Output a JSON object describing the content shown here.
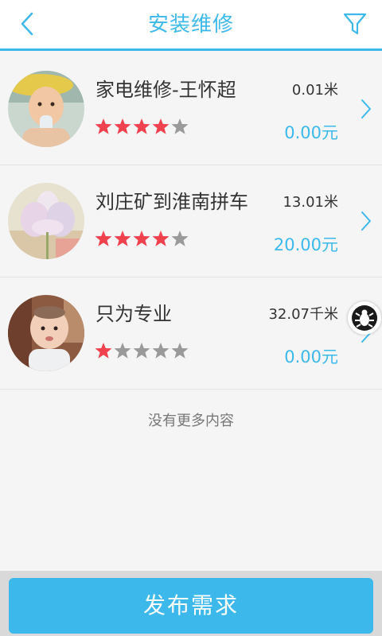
{
  "header": {
    "title": "安装维修",
    "back_icon": "chevron-left-icon",
    "filter_icon": "filter-funnel-icon"
  },
  "colors": {
    "accent": "#3cb9ea",
    "star_filled": "#f0414e",
    "star_empty": "#9a9a9a"
  },
  "list": {
    "items": [
      {
        "name": "家电维修-王怀超",
        "distance": "0.01米",
        "price": "0.00元",
        "rating": 4,
        "max_rating": 5
      },
      {
        "name": "刘庄矿到淮南拼车",
        "distance": "13.01米",
        "price": "20.00元",
        "rating": 4,
        "max_rating": 5
      },
      {
        "name": "只为专业",
        "distance": "32.07千米",
        "price": "0.00元",
        "rating": 1,
        "max_rating": 5
      }
    ],
    "end_text": "没有更多内容"
  },
  "footer": {
    "publish_label": "发布需求"
  }
}
